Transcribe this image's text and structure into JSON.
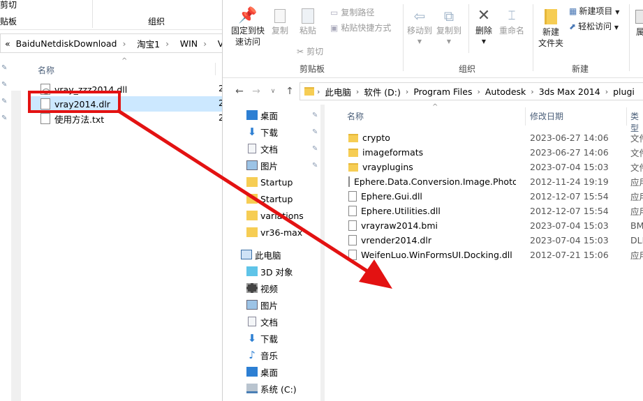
{
  "back_window": {
    "ribbon": {
      "cut_label": "剪切",
      "clipboard_group": "贴板",
      "organize_group": "组织"
    },
    "address": {
      "chevron": "«",
      "segments": [
        "BaiduNetdiskDownload",
        "淘宝1",
        "WIN",
        "Vray"
      ]
    },
    "column_header": "名称",
    "files": [
      {
        "name": "vray_zzz2014.dll",
        "type": "dll"
      },
      {
        "name": "vray2014.dlr",
        "type": "dlr",
        "selected": true
      },
      {
        "name": "使用方法.txt",
        "type": "txt"
      }
    ],
    "col_prefix": [
      "2",
      "2",
      "2"
    ]
  },
  "front_window": {
    "ribbon": {
      "pin_quick_access": "固定到快\n速访问",
      "copy": "复制",
      "paste": "粘贴",
      "copy_path": "复制路径",
      "paste_shortcut": "粘贴快捷方式",
      "cut": "剪切",
      "clipboard_group": "剪贴板",
      "move_to": "移动到",
      "copy_to": "复制到",
      "delete": "删除",
      "rename": "重命名",
      "organize_group": "组织",
      "new_folder": "新建\n文件夹",
      "new_item": "新建项目",
      "easy_access": "轻松访问",
      "new_group": "新建",
      "props": "属"
    },
    "address": {
      "segments": [
        "此电脑",
        "软件 (D:)",
        "Program Files",
        "Autodesk",
        "3ds Max 2014",
        "plugi"
      ]
    },
    "nav_pane": [
      {
        "label": "桌面",
        "icon": "desktop-icon",
        "pinned": true
      },
      {
        "label": "下载",
        "icon": "download-icon",
        "pinned": true
      },
      {
        "label": "文档",
        "icon": "document-icon",
        "pinned": true
      },
      {
        "label": "图片",
        "icon": "picture-icon",
        "pinned": true
      },
      {
        "label": "Startup",
        "icon": "folder-icon",
        "pinned": false
      },
      {
        "label": "Startup",
        "icon": "folder-icon",
        "pinned": false
      },
      {
        "label": "variations",
        "icon": "folder-icon",
        "pinned": false
      },
      {
        "label": "vr36-max",
        "icon": "folder-icon",
        "pinned": false
      },
      {
        "label": "此电脑",
        "icon": "computer-icon",
        "pinned": false
      },
      {
        "label": "3D 对象",
        "icon": "cube-icon",
        "pinned": false
      },
      {
        "label": "视频",
        "icon": "video-icon",
        "pinned": false
      },
      {
        "label": "图片",
        "icon": "picture-icon",
        "pinned": false
      },
      {
        "label": "文档",
        "icon": "document-icon",
        "pinned": false
      },
      {
        "label": "下载",
        "icon": "download-icon",
        "pinned": false
      },
      {
        "label": "音乐",
        "icon": "music-icon",
        "pinned": false
      },
      {
        "label": "桌面",
        "icon": "desktop-icon",
        "pinned": false
      },
      {
        "label": "系统 (C:)",
        "icon": "drive-icon",
        "pinned": false
      }
    ],
    "columns": {
      "name": "名称",
      "date": "修改日期",
      "type": "类型"
    },
    "files": [
      {
        "name": "crypto",
        "date": "2023-06-27 14:06",
        "type": "文件",
        "kind": "folder"
      },
      {
        "name": "imageformats",
        "date": "2023-06-27 14:06",
        "type": "文件",
        "kind": "folder"
      },
      {
        "name": "vrayplugins",
        "date": "2023-07-04 15:03",
        "type": "文件",
        "kind": "folder"
      },
      {
        "name": "Ephere.Data.Conversion.Image.Photo...",
        "date": "2012-11-24 19:19",
        "type": "应用",
        "kind": "dll"
      },
      {
        "name": "Ephere.Gui.dll",
        "date": "2012-12-07 15:54",
        "type": "应用",
        "kind": "dll"
      },
      {
        "name": "Ephere.Utilities.dll",
        "date": "2012-12-07 15:54",
        "type": "应用",
        "kind": "dll"
      },
      {
        "name": "vrayraw2014.bmi",
        "date": "2023-07-04 15:03",
        "type": "BMI",
        "kind": "file"
      },
      {
        "name": "vrender2014.dlr",
        "date": "2023-07-04 15:03",
        "type": "DLR",
        "kind": "file"
      },
      {
        "name": "WeifenLuo.WinFormsUI.Docking.dll",
        "date": "2012-07-21 15:06",
        "type": "应用",
        "kind": "dll"
      }
    ]
  },
  "annotation_color": "#e31212"
}
